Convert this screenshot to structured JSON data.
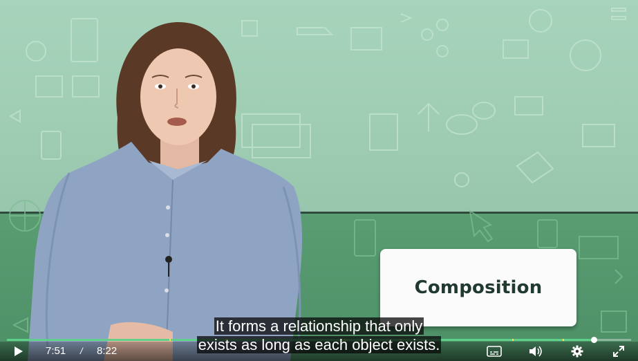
{
  "video": {
    "title_card": "Composition",
    "captions": [
      "It forms a relationship that only",
      "exists as long as each object exists."
    ]
  },
  "controls": {
    "current_time": "7:51",
    "separator": "/",
    "duration": "8:22",
    "progress_fraction": 0.94,
    "chapter_markers": [
      0.26,
      0.35,
      0.54,
      0.63,
      0.81,
      0.89
    ]
  },
  "icons": {
    "play": "play-icon",
    "captions": "captions-icon",
    "volume": "volume-icon",
    "settings": "gear-icon",
    "fullscreen": "fullscreen-icon"
  },
  "colors": {
    "background_top": "#a7d3bc",
    "background_bottom": "#5a9d73",
    "progress_played": "#5fd08a",
    "chapter_marker": "#f5e14b",
    "title_text": "#213a30"
  }
}
